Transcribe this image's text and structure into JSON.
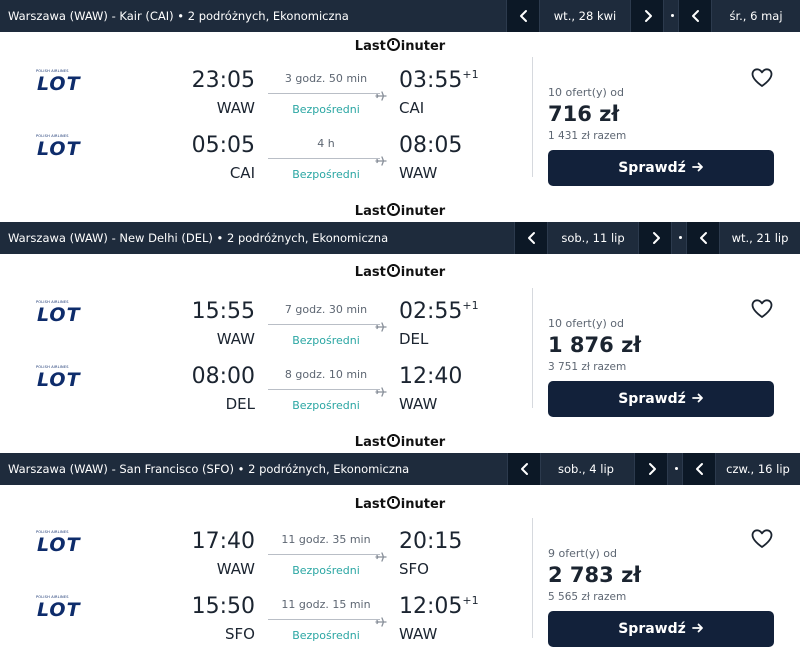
{
  "brand": "Lastminuter",
  "icons": {
    "prev": "chevron-left-icon",
    "next": "chevron-right-icon",
    "plane": "plane-icon",
    "favorite": "heart-icon",
    "arrow": "arrow-right-icon"
  },
  "colors": {
    "bar": "#1e2b3c",
    "nav_button": "#0c1826",
    "direct": "#2aa6a3",
    "button": "#12213a",
    "airline": "#0e2c6b"
  },
  "trips": [
    {
      "route": "Warszawa (WAW) - Kair (CAI)",
      "travelers": "2 podróżnych, Ekonomiczna",
      "depart_date": "wt., 28 kwi",
      "return_date": "śr., 6 maj",
      "legs": [
        {
          "airline": "LOT",
          "airline_tagline": "POLISH AIRLINES",
          "dep_time": "23:05",
          "dep_code": "WAW",
          "duration": "3 godz. 50 min",
          "stops": "Bezpośredni",
          "arr_time": "03:55",
          "day_offset": "+1",
          "arr_code": "CAI"
        },
        {
          "airline": "LOT",
          "airline_tagline": "POLISH AIRLINES",
          "dep_time": "05:05",
          "dep_code": "CAI",
          "duration": "4 h",
          "stops": "Bezpośredni",
          "arr_time": "08:05",
          "day_offset": "",
          "arr_code": "WAW"
        }
      ],
      "offers": "10 ofert(y) od",
      "price": "716 zł",
      "total": "1 431 zł razem",
      "cta": "Sprawdź"
    },
    {
      "route": "Warszawa (WAW) - New Delhi (DEL)",
      "travelers": "2 podróżnych, Ekonomiczna",
      "depart_date": "sob., 11 lip",
      "return_date": "wt., 21 lip",
      "legs": [
        {
          "airline": "LOT",
          "airline_tagline": "POLISH AIRLINES",
          "dep_time": "15:55",
          "dep_code": "WAW",
          "duration": "7 godz. 30 min",
          "stops": "Bezpośredni",
          "arr_time": "02:55",
          "day_offset": "+1",
          "arr_code": "DEL"
        },
        {
          "airline": "LOT",
          "airline_tagline": "POLISH AIRLINES",
          "dep_time": "08:00",
          "dep_code": "DEL",
          "duration": "8 godz. 10 min",
          "stops": "Bezpośredni",
          "arr_time": "12:40",
          "day_offset": "",
          "arr_code": "WAW"
        }
      ],
      "offers": "10 ofert(y) od",
      "price": "1 876 zł",
      "total": "3 751 zł razem",
      "cta": "Sprawdź"
    },
    {
      "route": "Warszawa (WAW) - San Francisco (SFO)",
      "travelers": "2 podróżnych, Ekonomiczna",
      "depart_date": "sob., 4 lip",
      "return_date": "czw., 16 lip",
      "legs": [
        {
          "airline": "LOT",
          "airline_tagline": "POLISH AIRLINES",
          "dep_time": "17:40",
          "dep_code": "WAW",
          "duration": "11 godz. 35 min",
          "stops": "Bezpośredni",
          "arr_time": "20:15",
          "day_offset": "",
          "arr_code": "SFO"
        },
        {
          "airline": "LOT",
          "airline_tagline": "POLISH AIRLINES",
          "dep_time": "15:50",
          "dep_code": "SFO",
          "duration": "11 godz. 15 min",
          "stops": "Bezpośredni",
          "arr_time": "12:05",
          "day_offset": "+1",
          "arr_code": "WAW"
        }
      ],
      "offers": "9 ofert(y) od",
      "price": "2 783 zł",
      "total": "5 565 zł razem",
      "cta": "Sprawdź"
    }
  ]
}
